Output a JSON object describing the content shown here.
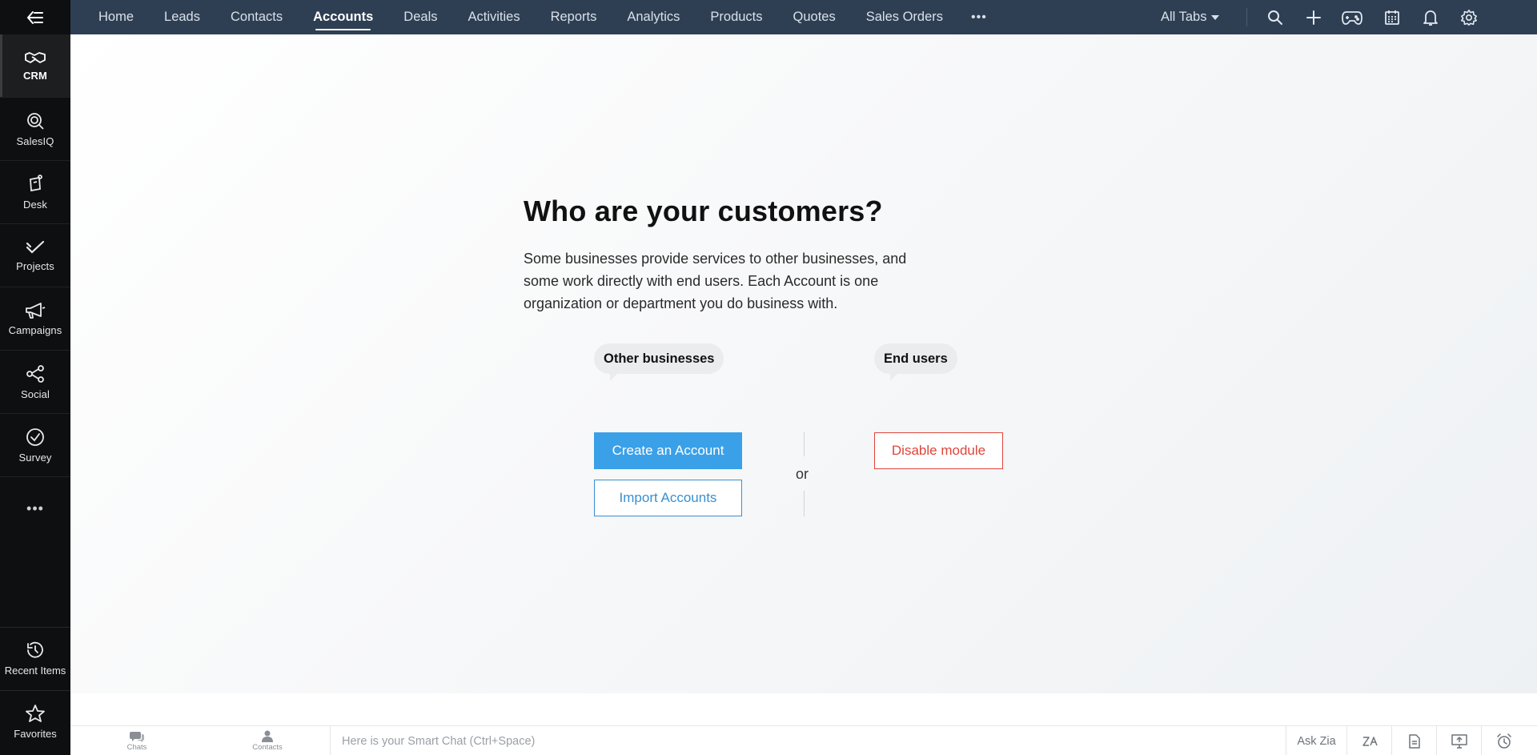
{
  "sidebar": {
    "items": [
      {
        "label": "CRM",
        "icon": "handshake-icon",
        "active": true
      },
      {
        "label": "SalesIQ",
        "icon": "salesiq-icon"
      },
      {
        "label": "Desk",
        "icon": "desk-icon"
      },
      {
        "label": "Projects",
        "icon": "projects-icon"
      },
      {
        "label": "Campaigns",
        "icon": "megaphone-icon"
      },
      {
        "label": "Social",
        "icon": "social-share-icon"
      },
      {
        "label": "Survey",
        "icon": "check-circle-icon"
      }
    ],
    "more_label": "•••",
    "bottom": [
      {
        "label": "Recent Items",
        "icon": "history-icon"
      },
      {
        "label": "Favorites",
        "icon": "star-icon"
      }
    ]
  },
  "nav": {
    "tabs": [
      "Home",
      "Leads",
      "Contacts",
      "Accounts",
      "Deals",
      "Activities",
      "Reports",
      "Analytics",
      "Products",
      "Quotes",
      "Sales Orders"
    ],
    "active_tab": "Accounts",
    "more_label": "•••",
    "all_tabs_label": "All Tabs",
    "icons": [
      "search-icon",
      "plus-icon",
      "gamepad-icon",
      "calendar-icon",
      "bell-icon",
      "gear-icon",
      "avatar"
    ]
  },
  "main": {
    "heading": "Who are your customers?",
    "description": "Some businesses provide services to other businesses, and some work directly with end users. Each Account is one organization or department you do business with.",
    "left_bubble": "Other businesses",
    "right_bubble": "End users",
    "create_button": "Create an Account",
    "import_button": "Import Accounts",
    "or_label": "or",
    "disable_button": "Disable module"
  },
  "bottom_bar": {
    "chats_label": "Chats",
    "contacts_label": "Contacts",
    "smart_chat_placeholder": "Here is your Smart Chat (Ctrl+Space)",
    "ask_zia_label": "Ask Zia"
  },
  "colors": {
    "topbar": "#2e3f54",
    "rail": "#0e0f10",
    "primary": "#3aa0e8",
    "danger": "#e0443a"
  }
}
